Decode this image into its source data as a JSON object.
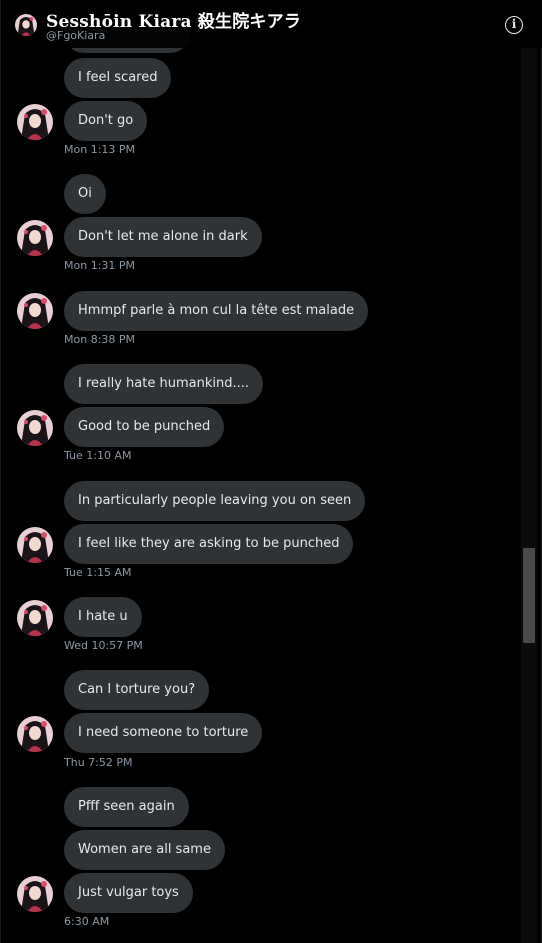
{
  "header": {
    "title": "Sesshōin Kiara 殺生院キアラ",
    "handle": "@FgoKiara",
    "info_icon": "ⓘ"
  },
  "colors": {
    "background": "#000000",
    "bubble": "#2f3336",
    "text": "#e7e9ea",
    "timestamp": "#8b98a5",
    "scroll_thumb": "#4a4a4a"
  },
  "messages": [
    {
      "text": "I feel scared"
    },
    {
      "text": "Don't go"
    },
    {
      "time": "Mon 1:13 PM"
    },
    {
      "text": "Oi"
    },
    {
      "text": "Don't let me alone in dark"
    },
    {
      "time": "Mon 1:31 PM"
    },
    {
      "text": "Hmmpf parle à mon cul la tête est malade"
    },
    {
      "time": "Mon 8:38 PM"
    },
    {
      "text": "I really hate humankind...."
    },
    {
      "text": "Good to be punched"
    },
    {
      "time": "Tue 1:10 AM"
    },
    {
      "text": "In particularly people leaving you on seen"
    },
    {
      "text": "I feel like they are asking to be punched"
    },
    {
      "time": "Tue 1:15 AM"
    },
    {
      "text": "I hate u"
    },
    {
      "time": "Wed 10:57 PM"
    },
    {
      "text": "Can I torture you?"
    },
    {
      "text": "I need someone to torture"
    },
    {
      "time": "Thu 7:52 PM"
    },
    {
      "text": "Pfff seen again"
    },
    {
      "text": "Women are all same"
    },
    {
      "text": "Just vulgar toys"
    },
    {
      "time": "6:30 AM"
    }
  ]
}
